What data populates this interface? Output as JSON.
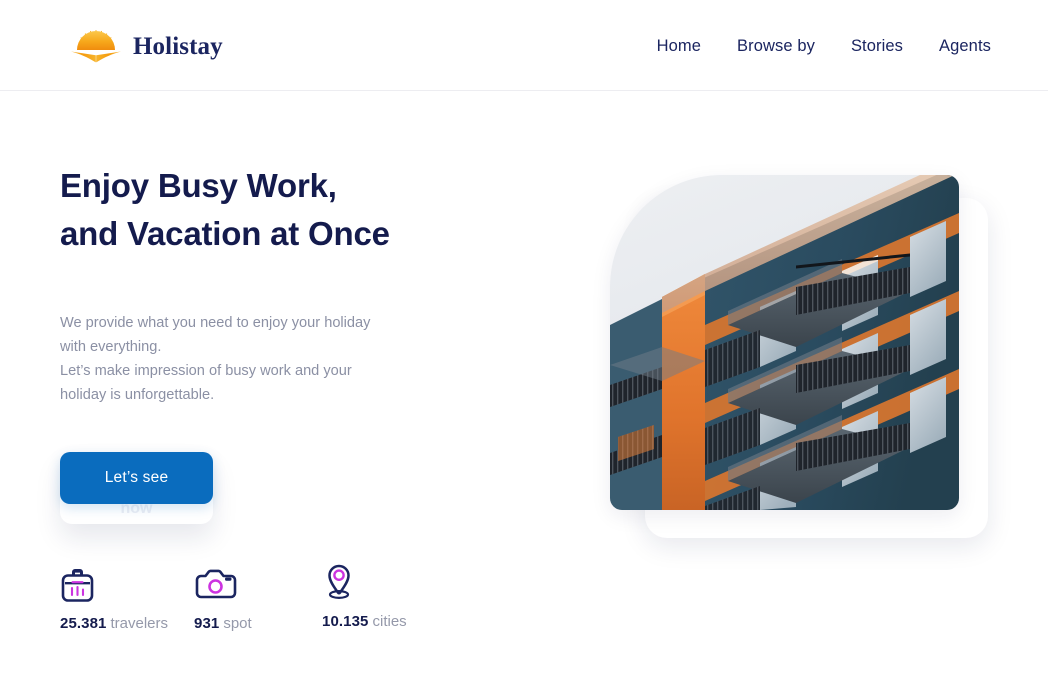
{
  "brand": {
    "name": "Holistay",
    "logo_icon": "sunrise-logo-icon",
    "logo_colors": {
      "sun": "#F6A81C",
      "sun_light": "#FBC02D",
      "text": "#1B2560"
    }
  },
  "nav": {
    "items": [
      {
        "label": "Home"
      },
      {
        "label": "Browse by"
      },
      {
        "label": "Stories"
      },
      {
        "label": "Agents"
      }
    ]
  },
  "hero": {
    "headline": "Enjoy Busy Work, and Vacation at Once",
    "subcopy_line1": "We provide what you need to enjoy your holiday with everything.",
    "subcopy_line2": "Let’s make impression of busy work and your holiday is unforgettable.",
    "cta_label": "Let’s see",
    "cta_ghost_label": "now",
    "cta_color": "#0A6CBE",
    "headline_color": "#141B4D",
    "subcopy_color": "#8B90A4"
  },
  "stats": {
    "items": [
      {
        "icon": "briefcase-icon",
        "value": "25.381",
        "label": "travelers"
      },
      {
        "icon": "camera-icon",
        "value": "931",
        "label": "spot"
      },
      {
        "icon": "location-pin-icon",
        "value": "10.135",
        "label": "cities"
      }
    ],
    "icon_outline_color": "#1B2560",
    "icon_accent_color": "#CC33E0"
  },
  "visual": {
    "photo_alt": "apartment-building-photo",
    "photo_colors": {
      "facade_blue": "#2C4E62",
      "facade_orange": "#E2752E",
      "sky": "#E8EAEE",
      "balcony": "#262B33"
    }
  }
}
